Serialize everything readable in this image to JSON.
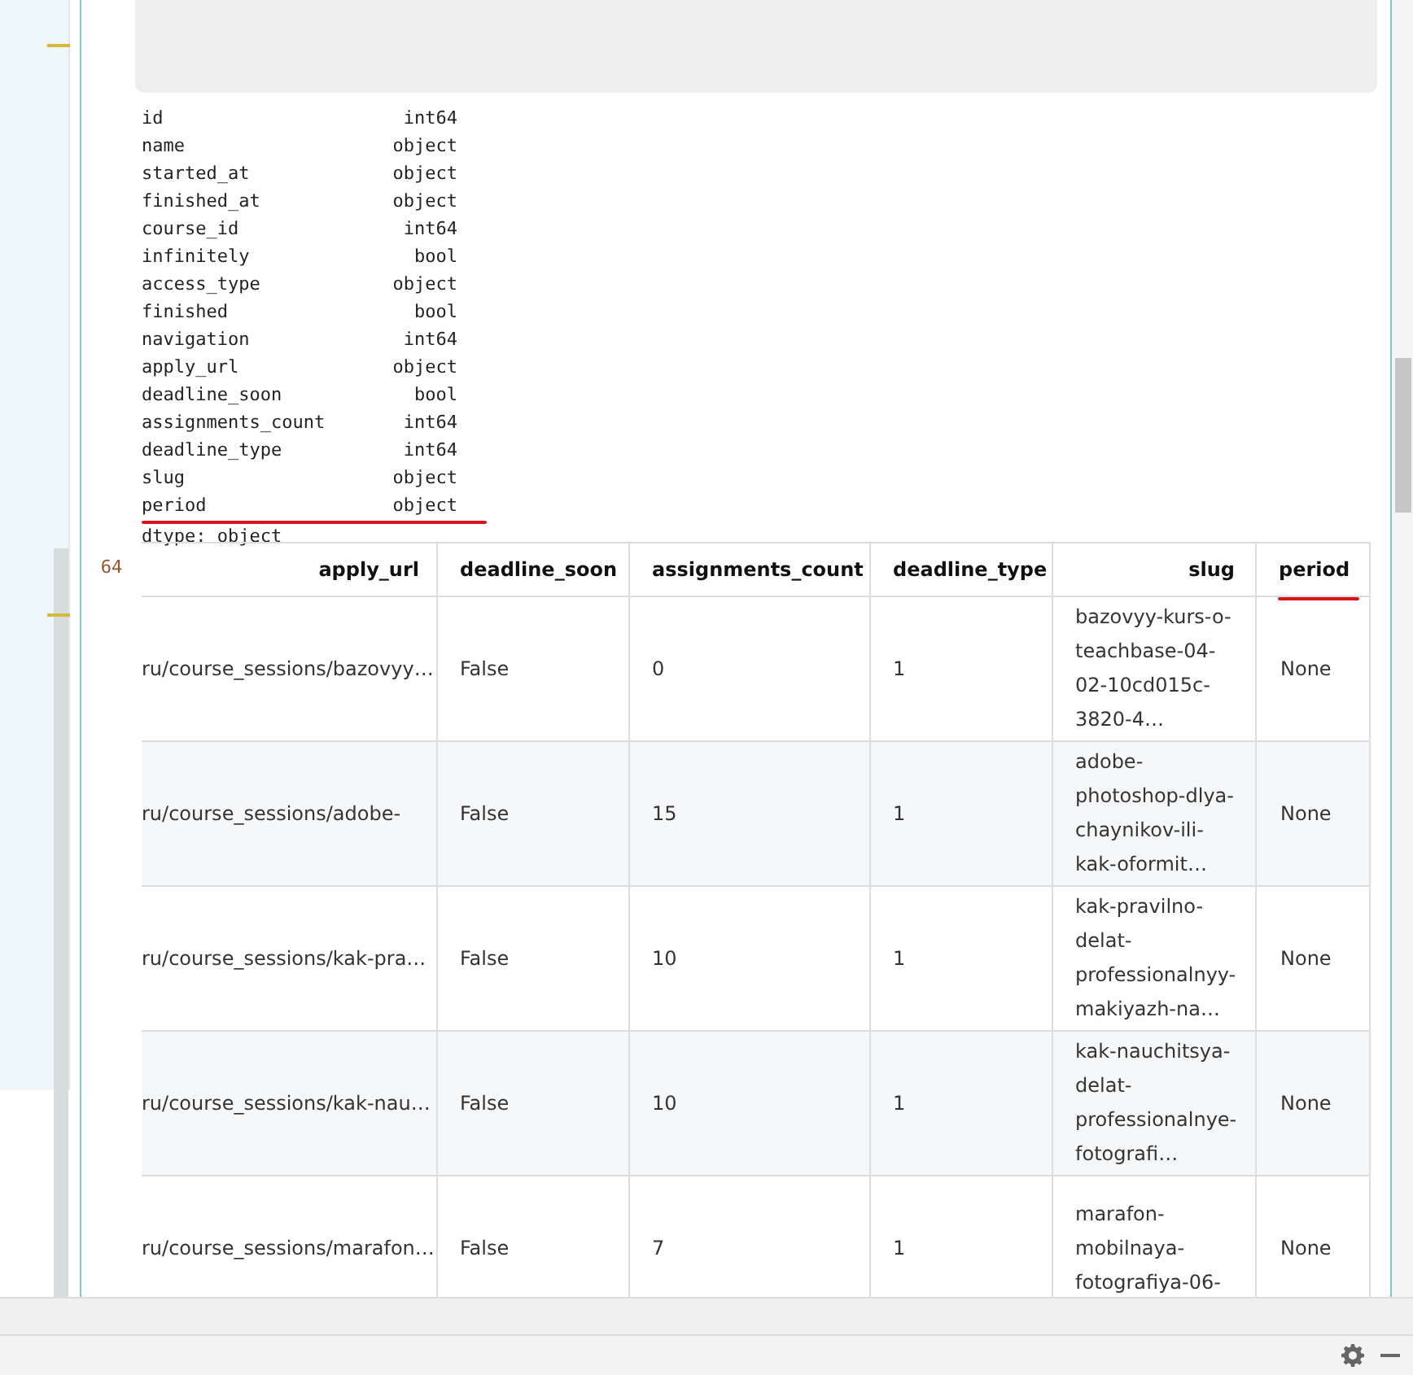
{
  "cell": {
    "dtypes": [
      {
        "name": "id",
        "type": "int64"
      },
      {
        "name": "name",
        "type": "object"
      },
      {
        "name": "started_at",
        "type": "object"
      },
      {
        "name": "finished_at",
        "type": "object"
      },
      {
        "name": "course_id",
        "type": "int64"
      },
      {
        "name": "infinitely",
        "type": "bool"
      },
      {
        "name": "access_type",
        "type": "object"
      },
      {
        "name": "finished",
        "type": "bool"
      },
      {
        "name": "navigation",
        "type": "int64"
      },
      {
        "name": "apply_url",
        "type": "object"
      },
      {
        "name": "deadline_soon",
        "type": "bool"
      },
      {
        "name": "assignments_count",
        "type": "int64"
      },
      {
        "name": "deadline_type",
        "type": "int64"
      },
      {
        "name": "slug",
        "type": "object"
      },
      {
        "name": "period",
        "type": "object"
      }
    ],
    "dtype_footer": "dtype: object",
    "output_prompt": "64",
    "table": {
      "columns": [
        "apply_url",
        "deadline_soon",
        "assignments_count",
        "deadline_type",
        "slug",
        "period"
      ],
      "rows": [
        [
          "ru/course_sessions/bazovyy…",
          "False",
          "0",
          "1",
          "bazovyy-kurs-o-teachbase-04-02-10cd015c-3820-4…",
          "None"
        ],
        [
          "ru/course_sessions/adobe-",
          "False",
          "15",
          "1",
          "adobe-photoshop-dlya-chaynikov-ili-kak-oformit…",
          "None"
        ],
        [
          "ru/course_sessions/kak-pra…",
          "False",
          "10",
          "1",
          "kak-pravilno-delat-professionalnyy-makiyazh-na…",
          "None"
        ],
        [
          "ru/course_sessions/kak-nau…",
          "False",
          "10",
          "1",
          "kak-nauchitsya-delat-professionalnye-fotografi…",
          "None"
        ],
        [
          "ru/course_sessions/marafon…",
          "False",
          "7",
          "1",
          "marafon-mobilnaya-fotografiya-06-",
          "None"
        ]
      ]
    }
  }
}
